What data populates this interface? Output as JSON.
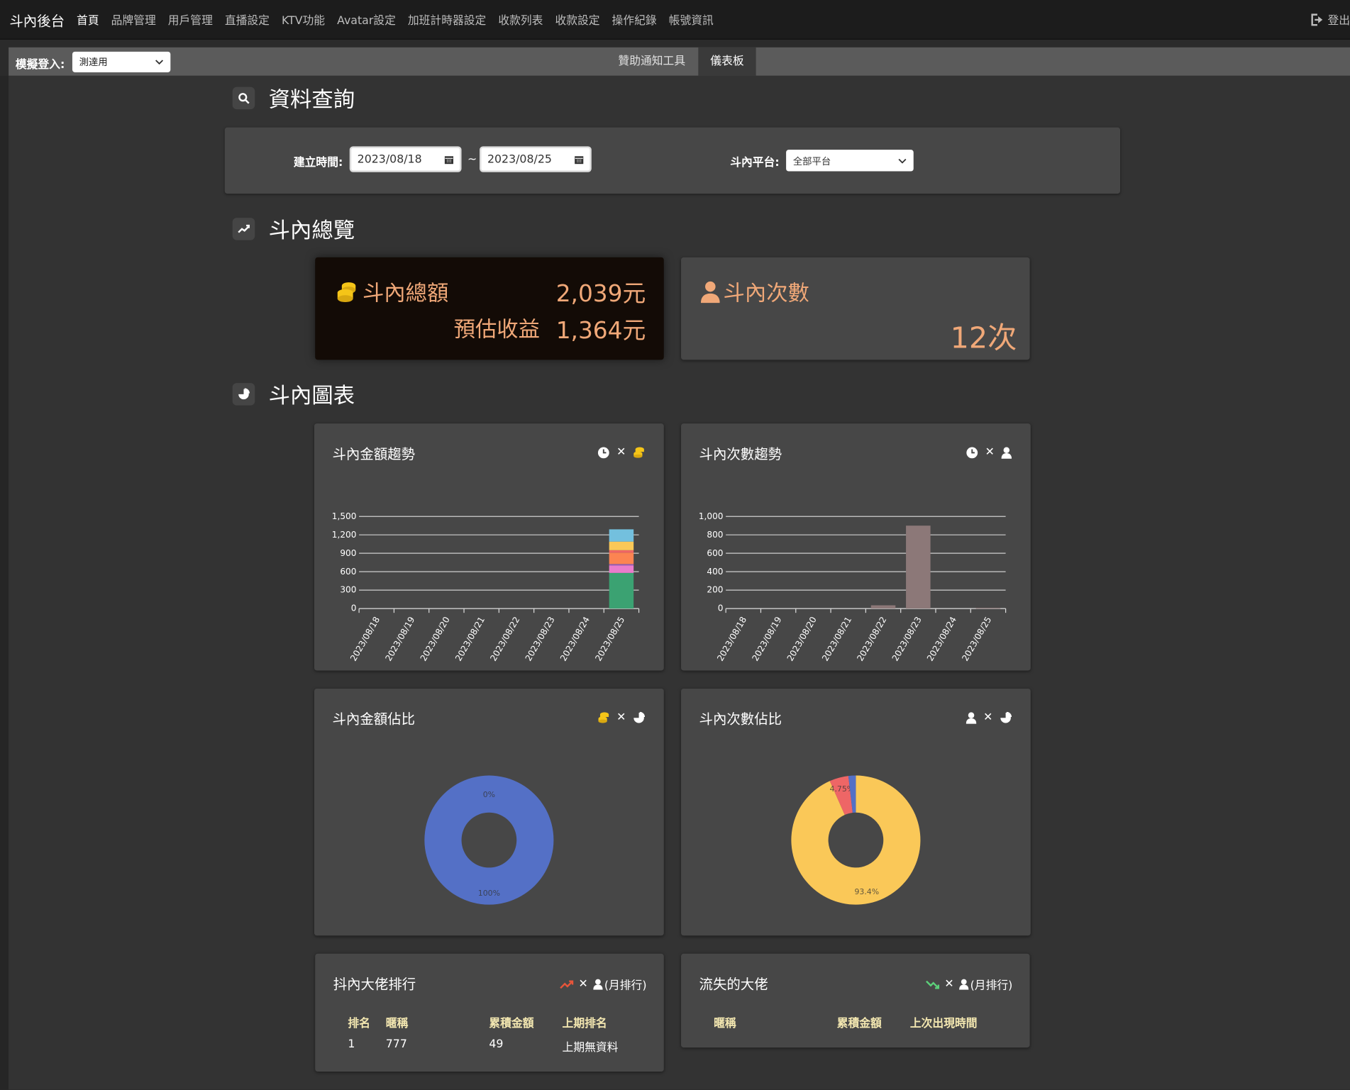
{
  "nav": {
    "brand": "斗內後台",
    "items": [
      "首頁",
      "品牌管理",
      "用戶管理",
      "直播設定",
      "KTV功能",
      "Avatar設定",
      "加班計時器設定",
      "收款列表",
      "收款設定",
      "操作紀錄",
      "帳號資訊"
    ],
    "logout": "登出"
  },
  "subbar": {
    "simulate_label": "模擬登入:",
    "simulate_value": "測達用",
    "tabs": [
      "贊助通知工具",
      "儀表板"
    ]
  },
  "query": {
    "title": "資料查詢",
    "date_label": "建立時間:",
    "date_from": "2023/08/18",
    "date_sep": "~",
    "date_to": "2023/08/25",
    "platform_label": "斗內平台:",
    "platform_value": "全部平台"
  },
  "overview": {
    "title": "斗內總覽",
    "total_label": "斗內總額",
    "total_value": "2,039元",
    "revenue_label": "預估收益",
    "revenue_value": "1,364元",
    "count_label": "斗內次數",
    "count_value": "12次"
  },
  "charts_section": {
    "title": "斗內圖表",
    "amount_trend_title": "斗內金額趨勢",
    "count_trend_title": "斗內次數趨勢",
    "amount_share_title": "斗內金額佔比",
    "count_share_title": "斗內次數佔比",
    "x_mark": "✕"
  },
  "chart_data": [
    {
      "type": "bar",
      "title": "斗內金額趨勢",
      "categories": [
        "2023/08/18",
        "2023/08/19",
        "2023/08/20",
        "2023/08/21",
        "2023/08/22",
        "2023/08/23",
        "2023/08/24",
        "2023/08/25"
      ],
      "yticks": [
        "0",
        "300",
        "600",
        "900",
        "1,200",
        "1,500"
      ],
      "ylim": [
        0,
        1500
      ],
      "stacked": true,
      "series": [
        {
          "color": "#3ba272",
          "values": [
            0,
            0,
            0,
            0,
            0,
            0,
            0,
            580
          ]
        },
        {
          "color": "#ea7ccc",
          "values": [
            0,
            0,
            0,
            0,
            0,
            0,
            0,
            120
          ]
        },
        {
          "color": "#9a60b4",
          "values": [
            0,
            0,
            0,
            0,
            0,
            0,
            0,
            25
          ]
        },
        {
          "color": "#fc8452",
          "values": [
            0,
            0,
            0,
            0,
            0,
            0,
            0,
            185
          ]
        },
        {
          "color": "#ee6666",
          "values": [
            0,
            0,
            0,
            0,
            0,
            0,
            0,
            40
          ]
        },
        {
          "color": "#fac858",
          "values": [
            0,
            0,
            0,
            0,
            0,
            0,
            0,
            140
          ]
        },
        {
          "color": "#73c0de",
          "values": [
            0,
            0,
            0,
            0,
            0,
            0,
            0,
            200
          ]
        }
      ]
    },
    {
      "type": "bar",
      "title": "斗內次數趨勢",
      "categories": [
        "2023/08/18",
        "2023/08/19",
        "2023/08/20",
        "2023/08/21",
        "2023/08/22",
        "2023/08/23",
        "2023/08/24",
        "2023/08/25"
      ],
      "yticks": [
        "0",
        "200",
        "400",
        "600",
        "800",
        "1,000"
      ],
      "ylim": [
        0,
        1000
      ],
      "series": [
        {
          "color": "#8c7878",
          "values": [
            0,
            0,
            0,
            0,
            35,
            900,
            0,
            8
          ]
        }
      ]
    },
    {
      "type": "pie",
      "title": "斗內金額佔比",
      "slices": [
        {
          "value": 100,
          "label": "100%",
          "color": "#5470c6"
        },
        {
          "value": 0,
          "label": "0%",
          "color": "#91cc75"
        }
      ]
    },
    {
      "type": "pie",
      "title": "斗內次數佔比",
      "slices": [
        {
          "value": 93.4,
          "label": "93.4%",
          "color": "#fac858"
        },
        {
          "value": 4.75,
          "label": "4.75%",
          "color": "#ee6666"
        },
        {
          "value": 1.85,
          "label": "",
          "color": "#5470c6"
        }
      ]
    }
  ],
  "ranking": {
    "title": "抖內大佬排行",
    "suffix": "(月排行)",
    "headers": [
      "排名",
      "暱稱",
      "累積金額",
      "上期排名"
    ],
    "rows": [
      [
        "1",
        "777",
        "49",
        "上期無資料"
      ]
    ]
  },
  "lost": {
    "title": "流失的大佬",
    "suffix": "(月排行)",
    "headers": [
      "暱稱",
      "累積金額",
      "上次出現時間"
    ]
  },
  "colors": {
    "accent_orange": "#f0a878",
    "coin_yellow": "#f5c518",
    "trend_up": "#e8553a",
    "trend_down": "#5cd07a"
  }
}
